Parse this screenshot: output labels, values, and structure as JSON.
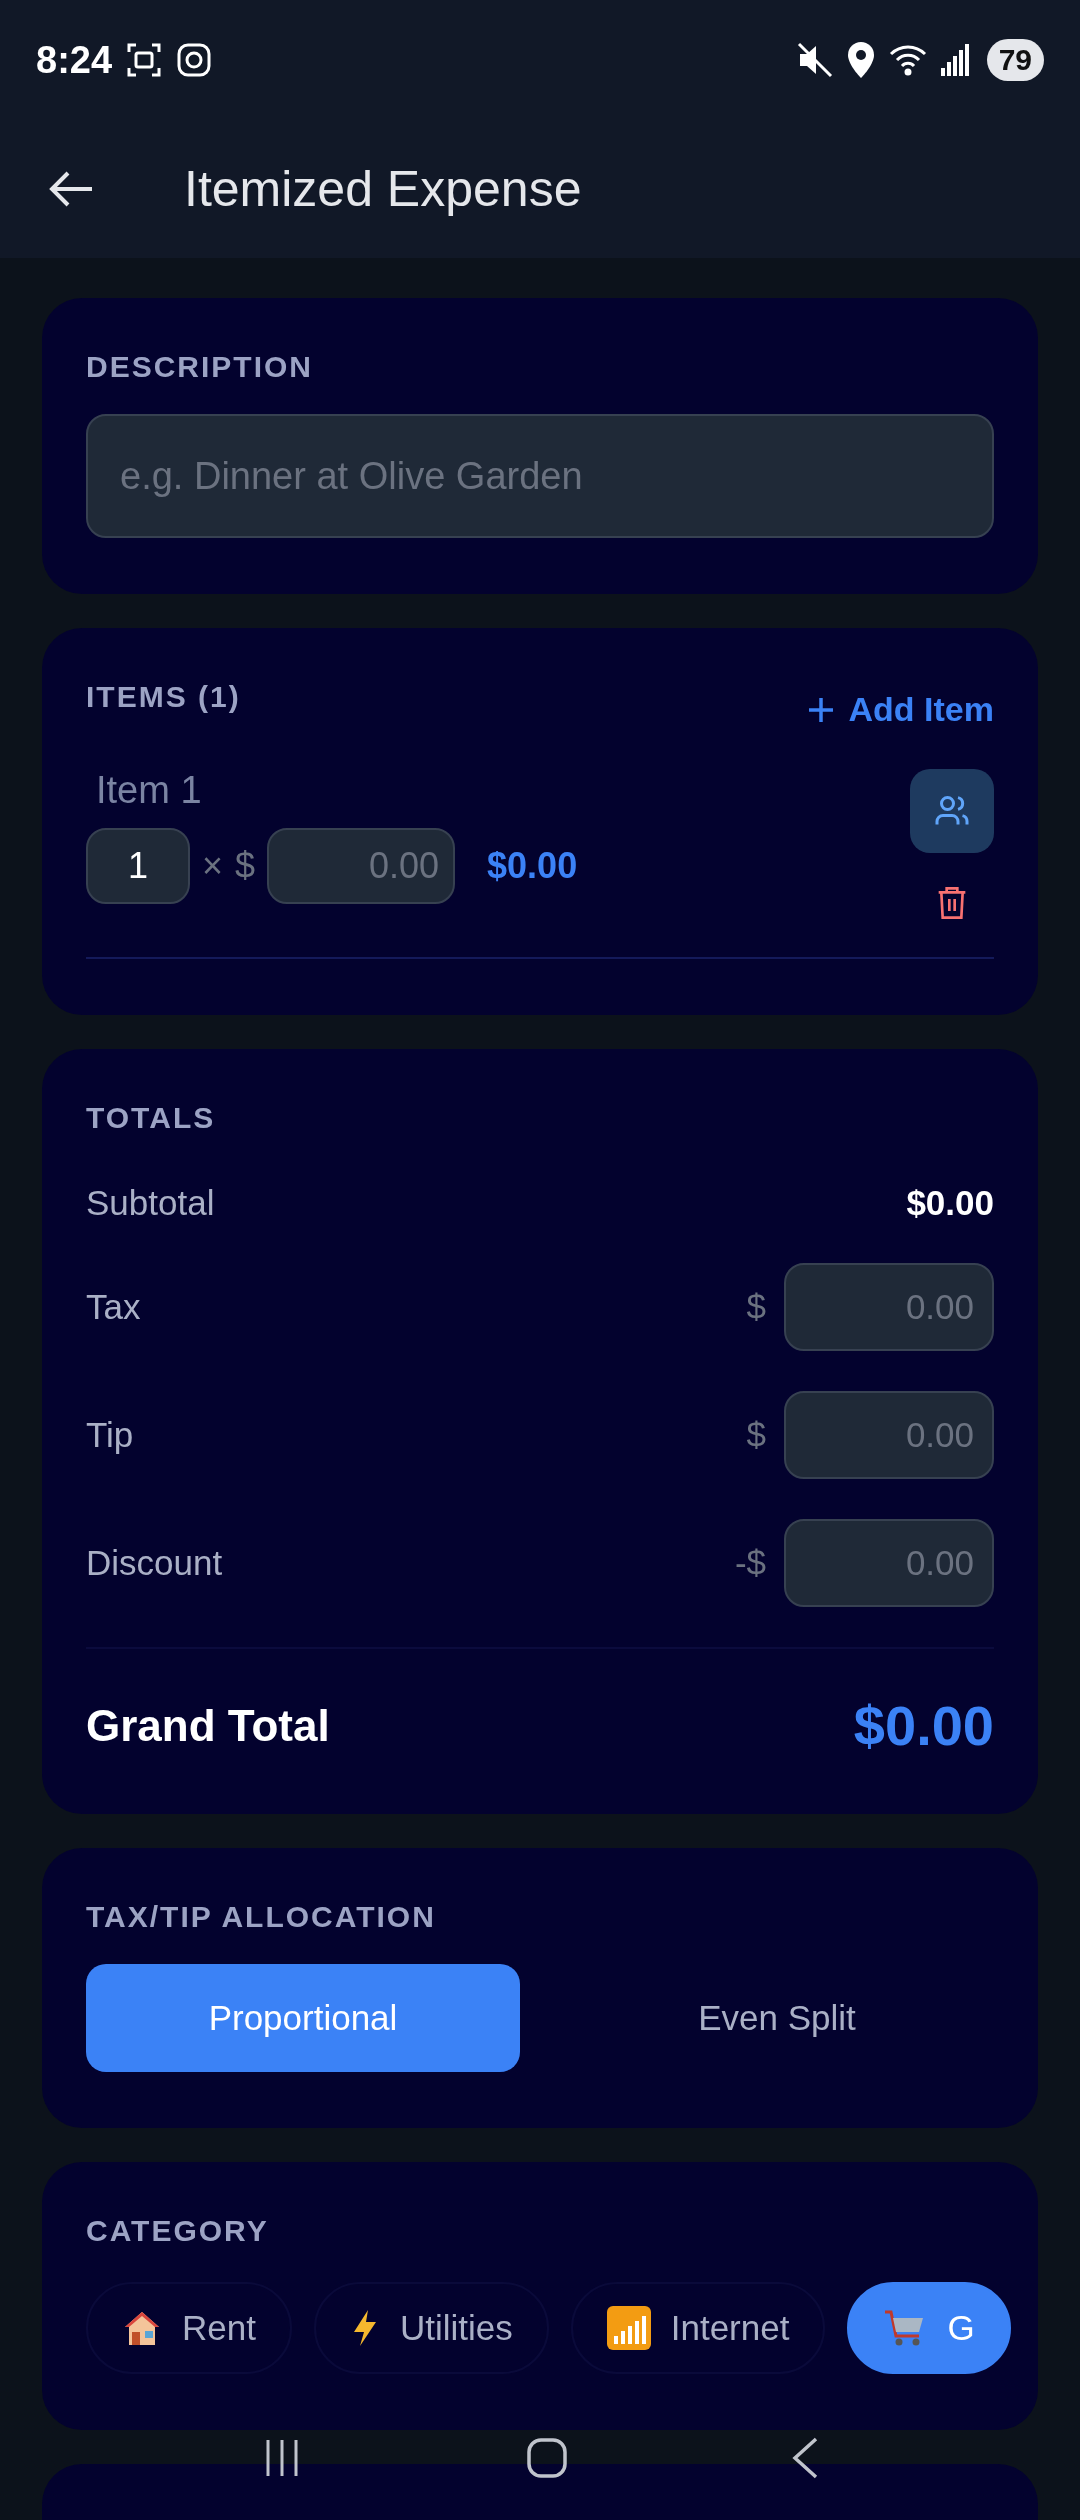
{
  "status_bar": {
    "time": "8:24",
    "battery": "79"
  },
  "header": {
    "title": "Itemized Expense"
  },
  "description": {
    "label": "DESCRIPTION",
    "placeholder": "e.g. Dinner at Olive Garden"
  },
  "items": {
    "label": "ITEMS (1)",
    "add_button": "Add Item",
    "list": [
      {
        "name": "Item 1",
        "quantity": "1",
        "times": "×",
        "currency": "$",
        "price_placeholder": "0.00",
        "amount": "$0.00"
      }
    ]
  },
  "totals": {
    "label": "TOTALS",
    "subtotal": {
      "label": "Subtotal",
      "value": "$0.00"
    },
    "fields": [
      {
        "label": "Tax",
        "prefix": "$",
        "placeholder": "0.00"
      },
      {
        "label": "Tip",
        "prefix": "$",
        "placeholder": "0.00"
      },
      {
        "label": "Discount",
        "prefix": "-$",
        "placeholder": "0.00"
      }
    ],
    "grand_total": {
      "label": "Grand Total",
      "value": "$0.00"
    }
  },
  "allocation": {
    "label": "TAX/TIP ALLOCATION",
    "options": [
      {
        "label": "Proportional",
        "selected": true
      },
      {
        "label": "Even Split",
        "selected": false
      }
    ]
  },
  "category": {
    "label": "CATEGORY",
    "chips": [
      {
        "kind": "house",
        "label": "Rent",
        "selected": false
      },
      {
        "kind": "bolt",
        "label": "Utilities",
        "selected": false
      },
      {
        "kind": "signal",
        "label": "Internet",
        "selected": false
      },
      {
        "kind": "cart",
        "label": "G",
        "selected": true
      }
    ]
  }
}
